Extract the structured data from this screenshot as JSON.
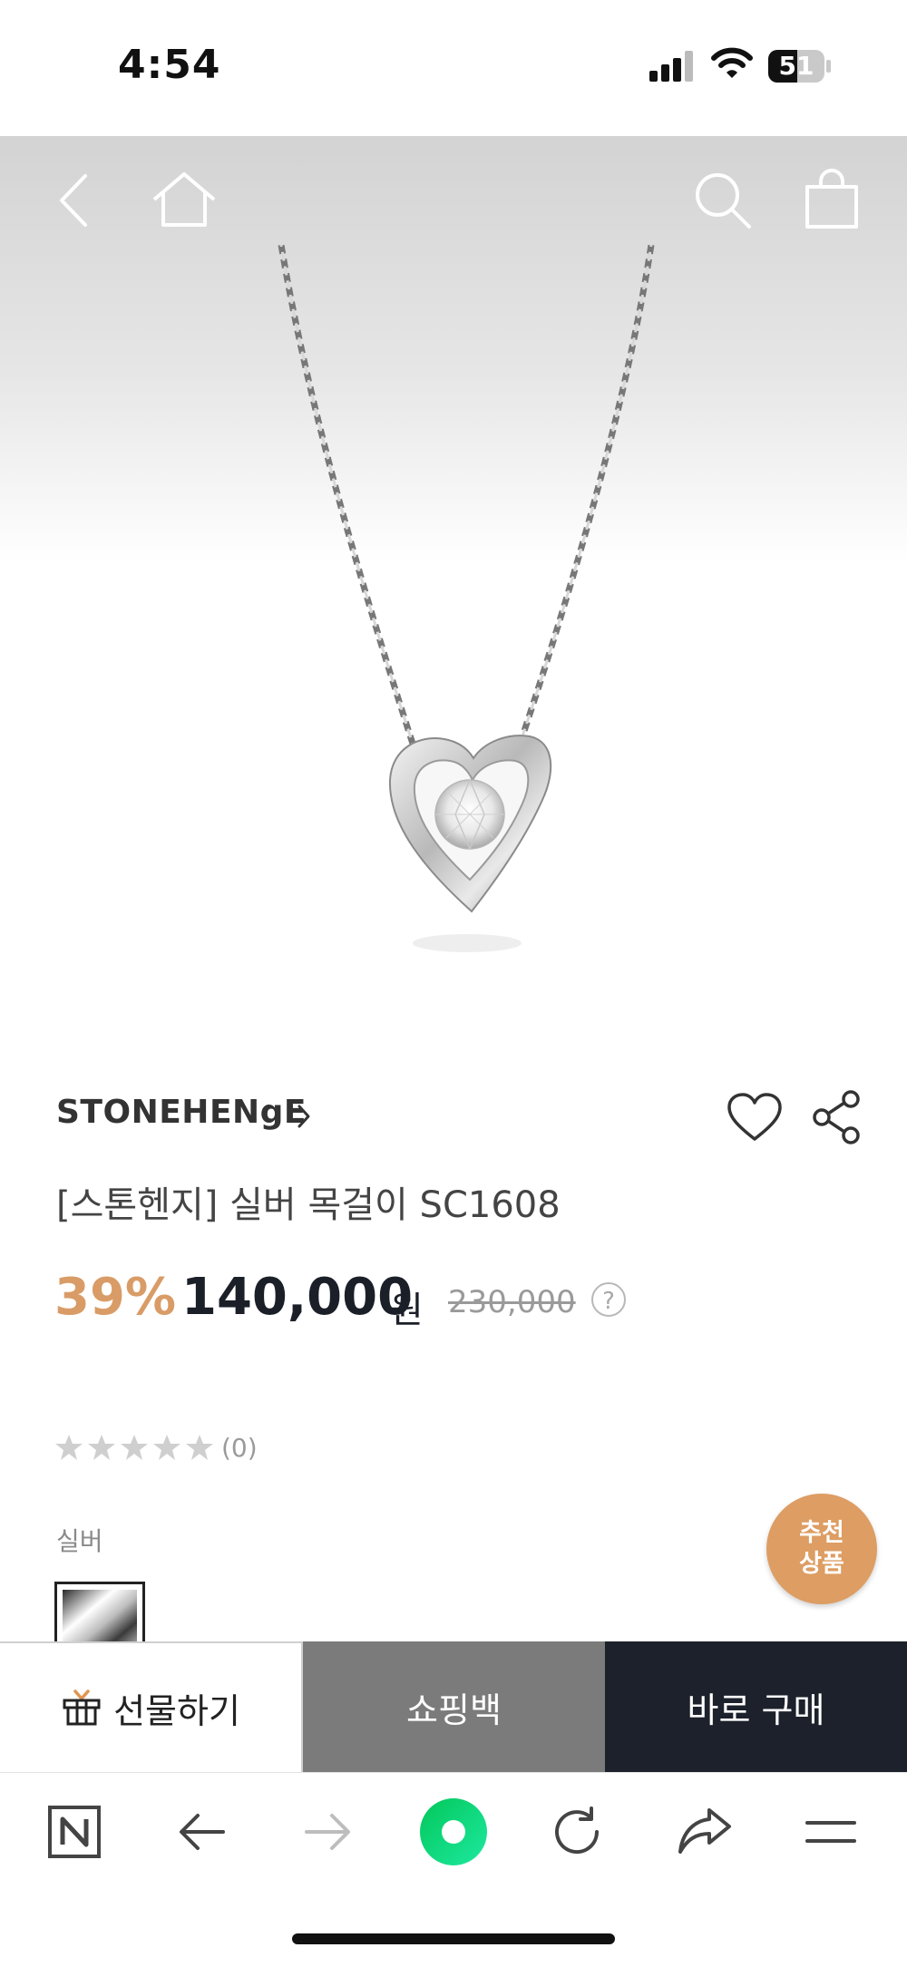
{
  "status_bar": {
    "time": "4:54",
    "battery": "51",
    "icons": [
      "signal-icon",
      "wifi-icon",
      "battery-icon"
    ]
  },
  "hero_nav": {
    "icons": [
      "back-icon",
      "home-icon",
      "search-icon",
      "shopping-bag-icon"
    ]
  },
  "product": {
    "brand": "STONEHENgE",
    "title": "[스톤헨지] 실버 목걸이 SC1608",
    "discount": "39%",
    "price": "140,000",
    "price_unit": "원",
    "original_price": "230,000",
    "price_help": "?",
    "rating": 0,
    "review_count": "(0)",
    "option_label": "실버"
  },
  "recommend": {
    "line1": "추천",
    "line2": "상품"
  },
  "purchase_bar": {
    "gift_label": "선물하기",
    "cart_label": "쇼핑백",
    "buy_label": "바로 구매"
  },
  "browser_toolbar": {
    "icons": [
      "naver-n-icon",
      "back-arrow-icon",
      "forward-arrow-icon",
      "green-dot-icon",
      "refresh-icon",
      "share-arrow-icon",
      "menu-icon"
    ]
  },
  "colors": {
    "accent": "#d99c67",
    "recommend_bg": "#dd9d63",
    "dark": "#1c212b",
    "cart_gray": "#7b7b7b",
    "naver_green": "#03c75a"
  }
}
